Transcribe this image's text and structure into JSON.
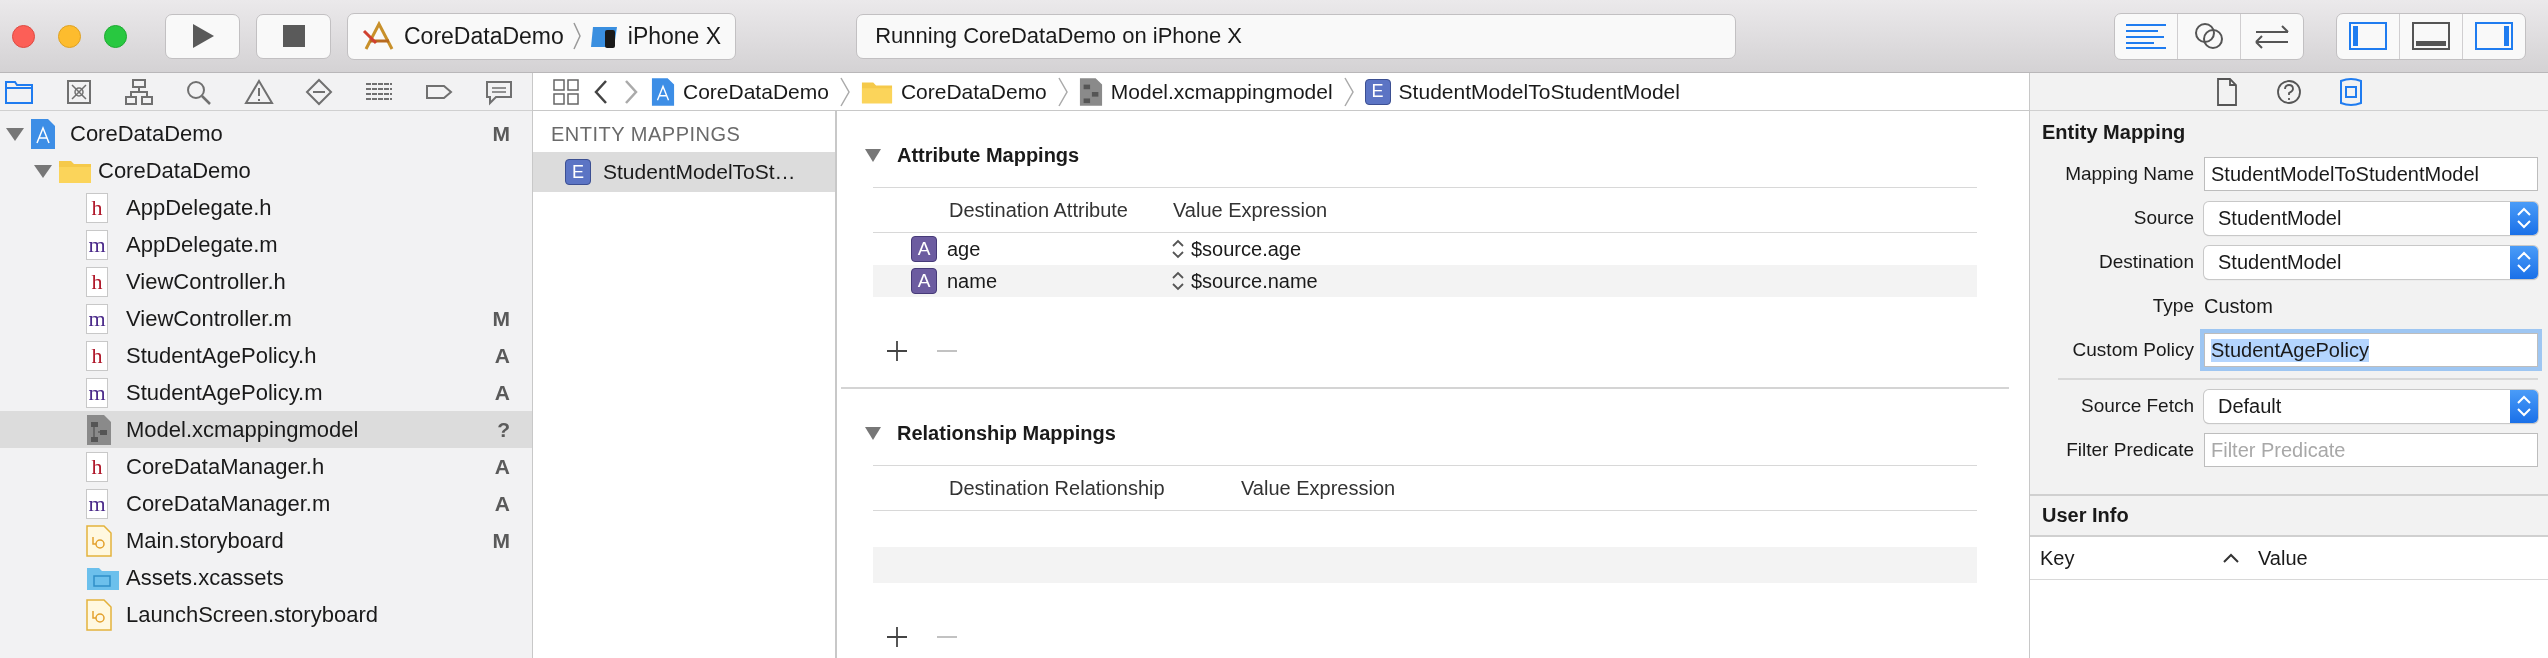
{
  "toolbar": {
    "scheme": "CoreDataDemo",
    "device": "iPhone X",
    "activity": "Running CoreDataDemo on iPhone X",
    "editor_modes": [
      {
        "kind": "standard",
        "selected": true
      },
      {
        "kind": "assistant",
        "selected": false
      },
      {
        "kind": "version",
        "selected": false
      }
    ],
    "view_toggles": [
      {
        "kind": "left",
        "on": true
      },
      {
        "kind": "bottom",
        "on": false
      },
      {
        "kind": "right",
        "on": true
      }
    ]
  },
  "navigator": {
    "tabs": [
      {
        "kind": "folder",
        "selected": true
      },
      {
        "kind": "source",
        "selected": false
      },
      {
        "kind": "symbol",
        "selected": false
      },
      {
        "kind": "find",
        "selected": false
      },
      {
        "kind": "issue",
        "selected": false
      },
      {
        "kind": "test",
        "selected": false
      },
      {
        "kind": "debug",
        "selected": false
      },
      {
        "kind": "breakpoint",
        "selected": false
      },
      {
        "kind": "report",
        "selected": false
      }
    ],
    "tree": [
      {
        "name": "CoreDataDemo",
        "kind": "project",
        "badge": "M",
        "expanded": true,
        "selected": false,
        "children": [
          {
            "name": "CoreDataDemo",
            "kind": "folder",
            "expanded": true,
            "selected": false,
            "children": [
              {
                "name": "AppDelegate.h",
                "kind": "h",
                "icon_text": "h",
                "selected": false
              },
              {
                "name": "AppDelegate.m",
                "kind": "m",
                "icon_text": "m",
                "selected": false
              },
              {
                "name": "ViewController.h",
                "kind": "h",
                "icon_text": "h",
                "selected": false
              },
              {
                "name": "ViewController.m",
                "kind": "m",
                "icon_text": "m",
                "badge": "M",
                "selected": false
              },
              {
                "name": "StudentAgePolicy.h",
                "kind": "h",
                "icon_text": "h",
                "badge": "A",
                "selected": false
              },
              {
                "name": "StudentAgePolicy.m",
                "kind": "m",
                "icon_text": "m",
                "badge": "A",
                "selected": false
              },
              {
                "name": "Model.xcmappingmodel",
                "kind": "mapping",
                "badge": "?",
                "selected": true
              },
              {
                "name": "CoreDataManager.h",
                "kind": "h",
                "icon_text": "h",
                "badge": "A",
                "selected": false
              },
              {
                "name": "CoreDataManager.m",
                "kind": "m",
                "icon_text": "m",
                "badge": "A",
                "selected": false
              },
              {
                "name": "Main.storyboard",
                "kind": "storyboard",
                "badge": "M",
                "selected": false
              },
              {
                "name": "Assets.xcassets",
                "kind": "assets",
                "selected": false
              },
              {
                "name": "LaunchScreen.storyboard",
                "kind": "storyboard",
                "selected": false
              }
            ]
          }
        ]
      }
    ]
  },
  "jump_bar": {
    "crumbs": [
      {
        "label": "CoreDataDemo",
        "kind": "project"
      },
      {
        "label": "CoreDataDemo",
        "kind": "folder"
      },
      {
        "label": "Model.xcmappingmodel",
        "kind": "mapping"
      },
      {
        "label": "StudentModelToStudentModel",
        "kind": "entity",
        "icon_text": "E"
      }
    ]
  },
  "entity_mappings": {
    "heading": "ENTITY MAPPINGS",
    "items": [
      {
        "label": "StudentModelToSt…",
        "icon_text": "E",
        "selected": true
      }
    ]
  },
  "attribute_mappings": {
    "title": "Attribute Mappings",
    "expanded": true,
    "columns": [
      "Destination Attribute",
      "Value Expression"
    ],
    "rows": [
      {
        "icon_text": "A",
        "destination": "age",
        "value_expression": "$source.age"
      },
      {
        "icon_text": "A",
        "destination": "name",
        "value_expression": "$source.name"
      }
    ]
  },
  "relationship_mappings": {
    "title": "Relationship Mappings",
    "expanded": true,
    "columns": [
      "Destination Relationship",
      "Value Expression"
    ]
  },
  "inspector": {
    "tabs": [
      {
        "kind": "file",
        "selected": false
      },
      {
        "kind": "help",
        "selected": false
      },
      {
        "kind": "attributes",
        "selected": true
      }
    ],
    "section_title": "Entity Mapping",
    "fields": [
      {
        "label": "Mapping Name",
        "kind": "text",
        "value": "StudentModelToStudentModel",
        "focused": false
      },
      {
        "label": "Source",
        "kind": "popup",
        "value": "StudentModel"
      },
      {
        "label": "Destination",
        "kind": "popup",
        "value": "StudentModel"
      },
      {
        "label": "Type",
        "kind": "static",
        "value": "Custom"
      },
      {
        "label": "Custom Policy",
        "kind": "text",
        "value": "StudentAgePolicy",
        "focused": true
      },
      {
        "kind": "separator"
      },
      {
        "label": "Source Fetch",
        "kind": "popup",
        "value": "Default"
      },
      {
        "label": "Filter Predicate",
        "kind": "text",
        "placeholder": "Filter Predicate",
        "focused": false
      }
    ],
    "user_info": {
      "title": "User Info",
      "columns": [
        "Key",
        "Value"
      ]
    }
  }
}
